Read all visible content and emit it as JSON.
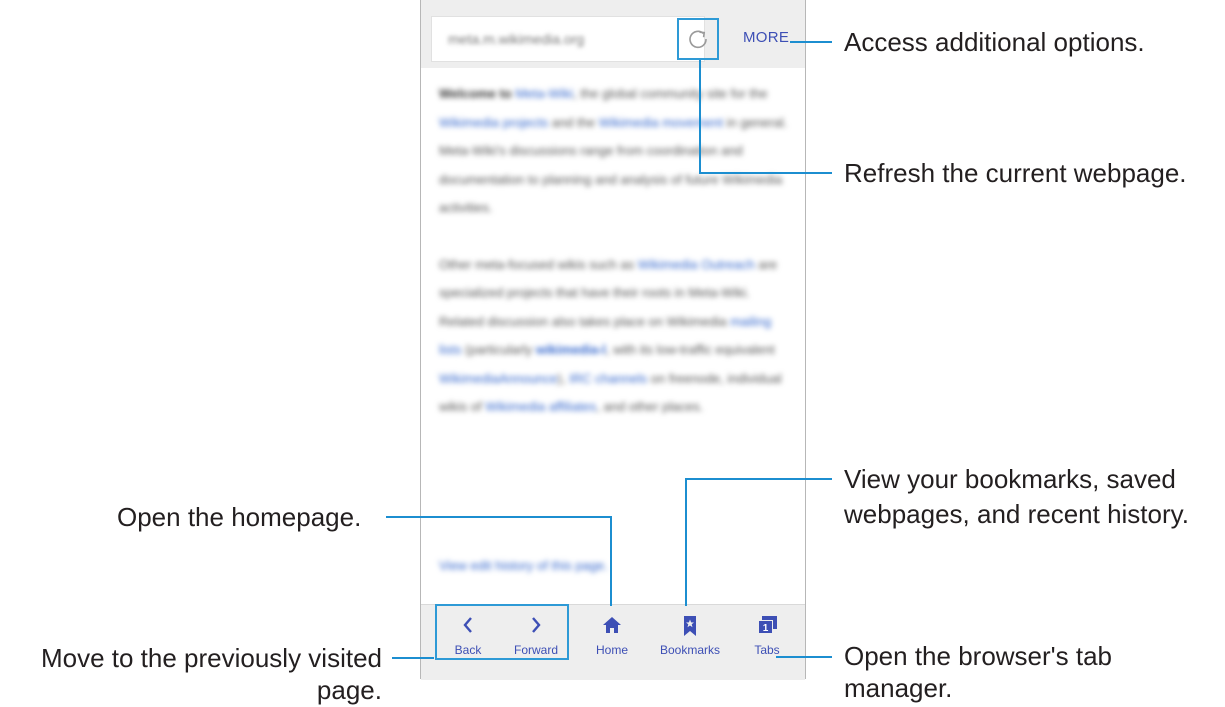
{
  "browser": {
    "url": "meta.m.wikimedia.org",
    "more_label": "MORE",
    "article": {
      "p1_intro_bold": "Welcome to",
      "p1_link_meta": "Meta-Wiki",
      "p1_a": ", the global community site for the",
      "p1_link_projects": "Wikimedia projects",
      "p1_b": "and the",
      "p1_link_movement": "Wikimedia movement",
      "p1_c": "in general. Meta-Wiki's discussions range from coordination and documentation to planning and analysis of future Wikimedia activities.",
      "p2_a": "Other meta-focused wikis such as",
      "p2_link_outreach": "Wikimedia Outreach",
      "p2_b": "are specialized projects that have their roots in Meta-Wiki. Related discussion also takes place on Wikimedia",
      "p2_link_lists": "mailing lists",
      "p2_c": "(particularly",
      "p2_bold_l": "wikimedia-l",
      "p2_d": ", with its low-traffic equivalent",
      "p2_link_announce": "WikimediaAnnounce",
      "p2_e": "),",
      "p2_link_irc": "IRC channels",
      "p2_f": "on freenode, individual wikis of",
      "p2_link_affiliates": "Wikimedia affiliates",
      "p2_g": ", and other places."
    },
    "history_link": "View edit history of this page.",
    "nav": {
      "back": "Back",
      "forward": "Forward",
      "home": "Home",
      "bookmarks": "Bookmarks",
      "tabs": "Tabs",
      "tab_count": "1"
    },
    "accent_color": "#3d4fb5",
    "callout_line_color": "#1c8ed0"
  },
  "callouts": {
    "more": "Access additional options.",
    "refresh": "Refresh the current webpage.",
    "bookmarks_line1": "View your bookmarks, saved",
    "bookmarks_line2": "webpages, and recent history.",
    "home": "Open the homepage.",
    "back_line1": "Move to the previously visited",
    "back_line2": "page.",
    "tabs_line1": "Open the browser's tab",
    "tabs_line2": "manager."
  }
}
